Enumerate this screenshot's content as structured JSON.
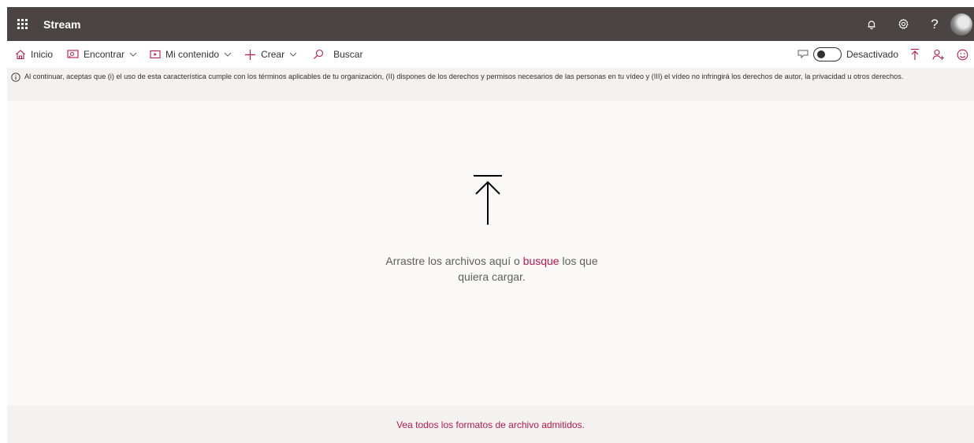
{
  "app": {
    "title": "Stream"
  },
  "suite": {
    "icons": [
      "waffle-icon",
      "bell-icon",
      "gear-icon",
      "help-icon",
      "avatar"
    ],
    "help_glyph": "?"
  },
  "nav": {
    "home": "Inicio",
    "discover": "Encontrar",
    "my_content": "Mi contenido",
    "create": "Crear",
    "search_placeholder": "Buscar"
  },
  "toolbar_right": {
    "toggle_label": "Desactivado",
    "toggle_state": "off"
  },
  "notice": {
    "text": "Al continuar, aceptas que (i) el uso de esta característica cumple con los términos aplicables de tu organización, (II) dispones de los derechos y permisos necesarios de las personas en tu vídeo y (III) el vídeo no infringirá los derechos de autor, la privacidad u otros derechos."
  },
  "dropzone": {
    "text_before": "Arrastre los archivos aquí o ",
    "link": "busque",
    "text_after": " los que quiera cargar."
  },
  "footer": {
    "link": "Vea todos los formatos de archivo admitidos."
  },
  "colors": {
    "accent": "#bc1948",
    "suitebar": "#4a4544",
    "background": "#faf9f8"
  }
}
